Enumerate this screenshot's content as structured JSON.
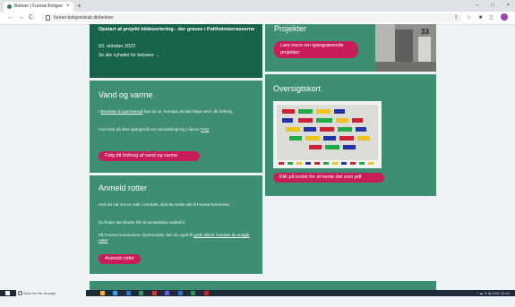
{
  "browser": {
    "tab_title": "Beboer | Furesø Boligselskab",
    "tab_close": "×",
    "new_tab": "+",
    "url": "fureso-boligselskab.dk/beboer",
    "nav": {
      "back": "←",
      "forward": "→",
      "reload": "C"
    },
    "window_controls": {
      "minimize": "–",
      "maximize": "□",
      "close": "×"
    }
  },
  "news_card": {
    "headline": "Opstart af projekt kildesortering - der graves i Paltholmterrasserne",
    "date": "03. oktober 2022",
    "link": "Se alle nyheder for beboere →"
  },
  "projects_card": {
    "title": "Projekter",
    "button": "Læs mere om igangværende projekter",
    "photo_number": "33"
  },
  "water_card": {
    "title": "Vand og varme",
    "text_prefix": "I ",
    "manual_link": "Brunatas brugermanual",
    "text_suffix": " kan du se, hvordan du kan følge med i dit forbrug.",
    "faq_prefix": "Find svar på dine spørgsmål om varmeafregning i denne ",
    "faq_link": "FAQ",
    "button": "Følg dit forbrug af vand og varme"
  },
  "map_card": {
    "title": "Oversigtskort",
    "button": "Klik på kortet for at hente det som pdf"
  },
  "rats_card": {
    "title": "Anmeld rotter",
    "text1": "Hvis du har set en rotte i området, skal du melde det til Furesø Kommune.",
    "text2": "Du finder det direkte link til anmeldelse nedenfor.",
    "text3_prefix": "På Furesø Kommunens hjemmeside, kan du også få ",
    "text3_link": "gode råd til, hvordan du undgår rotter",
    "button": "Anmeld rotter"
  },
  "taskbar": {
    "search_placeholder": "Skriv her for at søge",
    "tray_text": "^ ☁ ⊡ ◂) DAN  15:42"
  },
  "colors": {
    "dark_green": "#17634b",
    "mid_green": "#3e8f72",
    "button_pink": "#c91c5b",
    "page_bg": "#eef3f8"
  }
}
